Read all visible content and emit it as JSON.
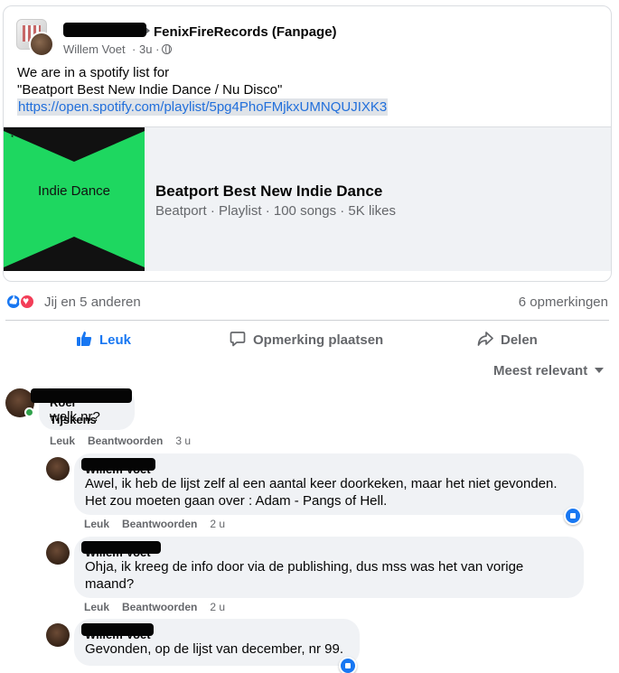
{
  "post": {
    "group_name": "FenixFireRecords (Fanpage)",
    "author": "Willem Voet",
    "time": "3u",
    "separator": "·",
    "text_line1": "We are in a spotify list for",
    "text_line2": "\"Beatport Best New Indie Dance / Nu Disco\"",
    "link": "https://open.spotify.com/playlist/5pg4PhoFMjkxUMNQUJIXK3",
    "icons": [
      "globe-icon"
    ]
  },
  "preview": {
    "image_label": "Indie Dance",
    "title": "Beatport Best New Indie Dance",
    "subtitle": "Beatport · Playlist · 100 songs · 5K likes",
    "accent": "#1ed760"
  },
  "reactions": {
    "text": "Jij en 5 anderen",
    "comments_count": "6 opmerkingen",
    "icons": [
      "like-icon",
      "love-icon"
    ]
  },
  "actions": {
    "like": "Leuk",
    "comment": "Opmerking plaatsen",
    "share": "Delen"
  },
  "sort": {
    "label": "Meest relevant"
  },
  "comments": [
    {
      "author": "Roel Tijskens",
      "text": "welk nr?",
      "like": "Leuk",
      "reply": "Beantwoorden",
      "time": "3 u"
    },
    {
      "author": "Willem Voet",
      "text_line1": "Awel, ik heb de lijst zelf al een aantal keer doorkeken, maar het niet gevonden.",
      "text_line2": "Het zou moeten gaan over : Adam - Pangs of Hell.",
      "like": "Leuk",
      "reply": "Beantwoorden",
      "time": "2 u"
    },
    {
      "author": "Willem Voet",
      "text_line1": "Ohja, ik kreeg de info door via de publishing, dus mss was het van vorige",
      "text_line2": "maand?",
      "like": "Leuk",
      "reply": "Beantwoorden",
      "time": "2 u"
    },
    {
      "author": "Willem Voet",
      "text": "Gevonden, op de lijst van december, nr 99."
    }
  ],
  "colors": {
    "facebook_blue": "#1877f2",
    "link": "#216fdb",
    "muted": "#65676b"
  }
}
